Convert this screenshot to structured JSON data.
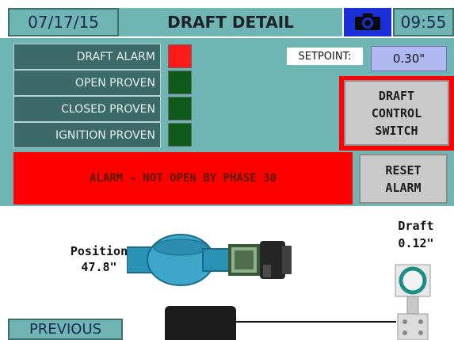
{
  "header": {
    "date": "07/17/15",
    "title": "DRAFT DETAIL",
    "time": "09:55",
    "camera_icon": "camera-icon"
  },
  "indicators": [
    {
      "label": "DRAFT ALARM",
      "state": "alarm",
      "color": "#ff1a1a"
    },
    {
      "label": "OPEN PROVEN",
      "state": "off",
      "color": "#0f5a1a"
    },
    {
      "label": "CLOSED PROVEN",
      "state": "off",
      "color": "#0f5a1a"
    },
    {
      "label": "IGNITION PROVEN",
      "state": "off",
      "color": "#0f5a1a"
    }
  ],
  "setpoint": {
    "label": "SETPOINT:",
    "value": "0.30\""
  },
  "draft_control_button": {
    "line1": "DRAFT",
    "line2": "CONTROL",
    "line3": "SWITCH"
  },
  "alarm_banner": {
    "text": "ALARM - NOT OPEN BY PHASE 30",
    "color": "#ff0000"
  },
  "reset_button": {
    "line1": "RESET",
    "line2": "ALARM"
  },
  "position": {
    "label": "Position",
    "value": "47.8\""
  },
  "draft": {
    "label": "Draft",
    "value": "0.12\""
  },
  "nav": {
    "previous": "PREVIOUS"
  },
  "colors": {
    "teal": "#6fb5b4",
    "dark_teal": "#3b6a68",
    "alarm_red": "#ff0000",
    "setpoint_bg": "#b0b8f0"
  }
}
